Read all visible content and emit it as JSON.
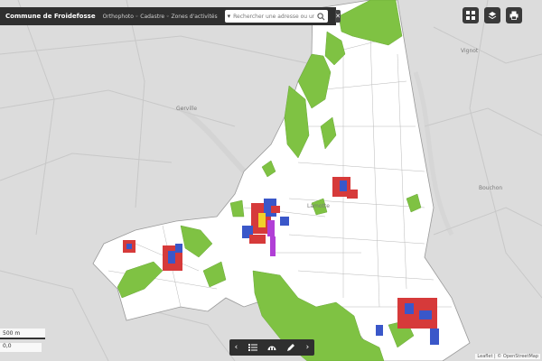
{
  "header": {
    "title": "Commune de Froidefosse",
    "subtitle": "Orthophoto ◦ Cadastre ◦ Zones d'activités",
    "search_placeholder": "Rechercher une adresse ou un lieu",
    "close_label": "✕"
  },
  "toolbar": {
    "buttons": [
      "grid-icon",
      "layers-icon",
      "print-icon"
    ]
  },
  "bottombar": {
    "prev_label": "‹",
    "next_label": "›"
  },
  "map": {
    "place_labels": [
      "Vignot",
      "Gerville",
      "Lamotte",
      "Bouchon"
    ],
    "scale_label": "500 m",
    "coords_label": "0,0",
    "attribution": "Leaflet | © OpenStreetMap"
  },
  "colors": {
    "commune_fill": "#ffffff",
    "forest": "#7fc243",
    "built_red": "#d63a3a",
    "built_blue": "#3a57c9",
    "built_purple": "#b13fd6",
    "built_yellow": "#f0d12a",
    "basemap": "#dcdcdc"
  }
}
